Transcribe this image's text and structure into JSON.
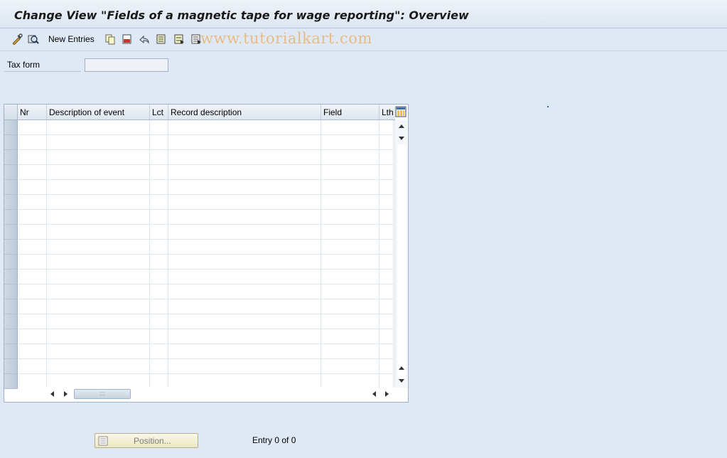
{
  "window": {
    "title": "Change View \"Fields of a magnetic tape for wage reporting\": Overview"
  },
  "toolbar": {
    "new_entries_label": "New Entries",
    "watermark": "www.tutorialkart.com",
    "icons": [
      "display-change-icon",
      "where-used-icon",
      "copy-icon",
      "delete-icon",
      "undo-icon",
      "select-all-icon",
      "select-block-icon",
      "deselect-all-icon"
    ]
  },
  "selection": {
    "tax_form_label": "Tax form",
    "tax_form_value": ""
  },
  "table": {
    "columns": [
      "Nr",
      "Description of event",
      "Lct",
      "Record description",
      "Field",
      "Lth"
    ],
    "row_count": 18,
    "rows": []
  },
  "footer": {
    "position_button_label": "Position...",
    "entry_status": "Entry 0 of 0"
  }
}
